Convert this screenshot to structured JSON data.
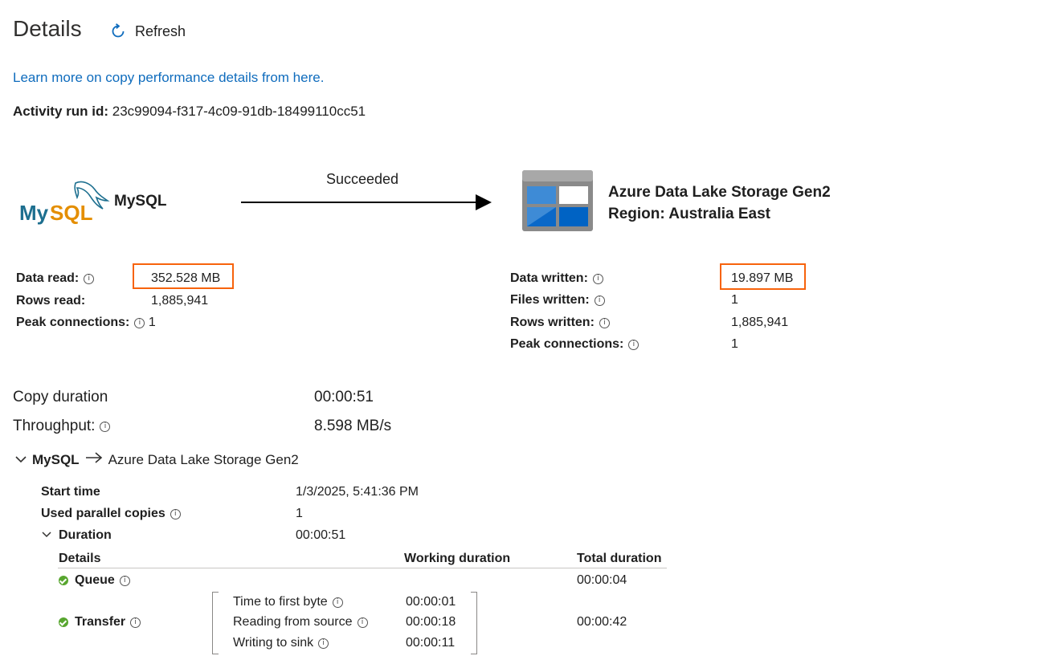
{
  "header": {
    "title": "Details",
    "refresh_label": "Refresh"
  },
  "learn_link": "Learn more on copy performance details from here.",
  "activity": {
    "label": "Activity run id:",
    "value": "23c99094-f317-4c09-91db-18499110cc51"
  },
  "flow": {
    "status": "Succeeded",
    "source_name": "MySQL",
    "sink_name": "Azure Data Lake Storage Gen2",
    "sink_region": "Region: Australia East"
  },
  "source_stats": {
    "data_read_label": "Data read:",
    "data_read_value": "352.528 MB",
    "rows_read_label": "Rows read:",
    "rows_read_value": "1,885,941",
    "peak_label": "Peak connections:",
    "peak_value": "1"
  },
  "sink_stats": {
    "data_written_label": "Data written:",
    "data_written_value": "19.897 MB",
    "files_written_label": "Files written:",
    "files_written_value": "1",
    "rows_written_label": "Rows written:",
    "rows_written_value": "1,885,941",
    "peak_label": "Peak connections:",
    "peak_value": "1"
  },
  "summary": {
    "copy_duration_label": "Copy duration",
    "copy_duration_value": "00:00:51",
    "throughput_label": "Throughput:",
    "throughput_value": "8.598 MB/s"
  },
  "group": {
    "source": "MySQL",
    "sink": "Azure Data Lake Storage Gen2",
    "start_time_label": "Start time",
    "start_time_value": "1/3/2025, 5:41:36 PM",
    "parallel_label": "Used parallel copies",
    "parallel_value": "1",
    "duration_label": "Duration",
    "duration_value": "00:00:51"
  },
  "duration_table": {
    "headers": [
      "Details",
      "Working duration",
      "Total duration"
    ],
    "queue_label": "Queue",
    "queue_total": "00:00:04",
    "transfer_label": "Transfer",
    "transfer_total": "00:00:42",
    "steps": [
      {
        "label": "Time to first byte",
        "value": "00:00:01"
      },
      {
        "label": "Reading from source",
        "value": "00:00:18"
      },
      {
        "label": "Writing to sink",
        "value": "00:00:11"
      }
    ]
  },
  "colors": {
    "link": "#0f6cbd",
    "highlight": "#f7630c",
    "success": "#58a62f"
  }
}
